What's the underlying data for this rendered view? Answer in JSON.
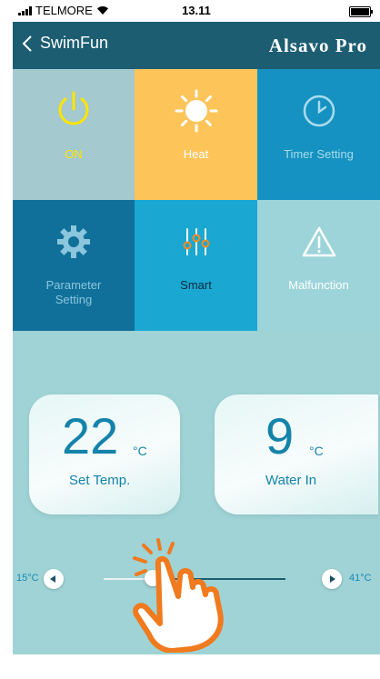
{
  "status_bar": {
    "carrier": "TELMORE",
    "time": "13.11"
  },
  "nav": {
    "back_label": "SwimFun",
    "brand": "Alsavo Pro"
  },
  "tiles": [
    {
      "label": "ON",
      "icon": "power-icon"
    },
    {
      "label": "Heat",
      "icon": "sun-icon"
    },
    {
      "label": "Timer Setting",
      "icon": "clock-icon"
    },
    {
      "label": "Parameter Setting",
      "icon": "gear-icon"
    },
    {
      "label": "Smart",
      "icon": "sliders-icon"
    },
    {
      "label": "Malfunction",
      "icon": "warning-icon"
    }
  ],
  "set_temp": {
    "value": "22",
    "unit": "°C",
    "label": "Set Temp."
  },
  "water_in": {
    "value": "9",
    "unit": "°C",
    "label": "Water In"
  },
  "slider": {
    "min_label": "15°C",
    "max_label": "41°C",
    "min": 15,
    "max": 41,
    "value": 22
  },
  "colors": {
    "nav_bar": "#1c5d72",
    "background": "#9fd3d5",
    "tile_on": "#a4c9ce",
    "tile_heat": "#fdc45a",
    "tile_timer": "#1592c2",
    "tile_param": "#10709a",
    "tile_smart": "#1aa7d1",
    "tile_malfunction": "#9cd4da",
    "temp_text": "#1483aa",
    "pointer_hand": "#f07a1d"
  }
}
